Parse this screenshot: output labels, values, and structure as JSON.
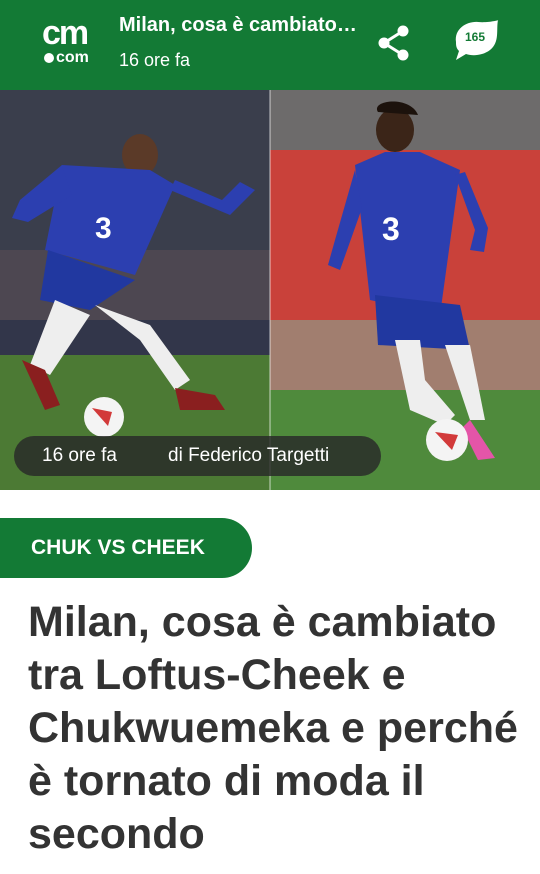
{
  "header": {
    "logo_top": "cm",
    "logo_bottom": "com",
    "title": "Milan, cosa è cambiato tra Loftus-Cheek e Chukwuemeka e perché è tornato di moda il secondo",
    "time": "16 ore fa",
    "share_icon": "share-icon",
    "comments_count": "165",
    "brand_color": "#137a35"
  },
  "hero": {
    "time": "16 ore fa",
    "author": "di Federico Targetti",
    "left_player_number": "3",
    "right_player_number": "3"
  },
  "article": {
    "tag": "CHUK VS CHEEK",
    "headline": "Milan, cosa è cambiato tra Loftus-Cheek e Chukwuemeka e perché è tornato di moda il secondo"
  }
}
